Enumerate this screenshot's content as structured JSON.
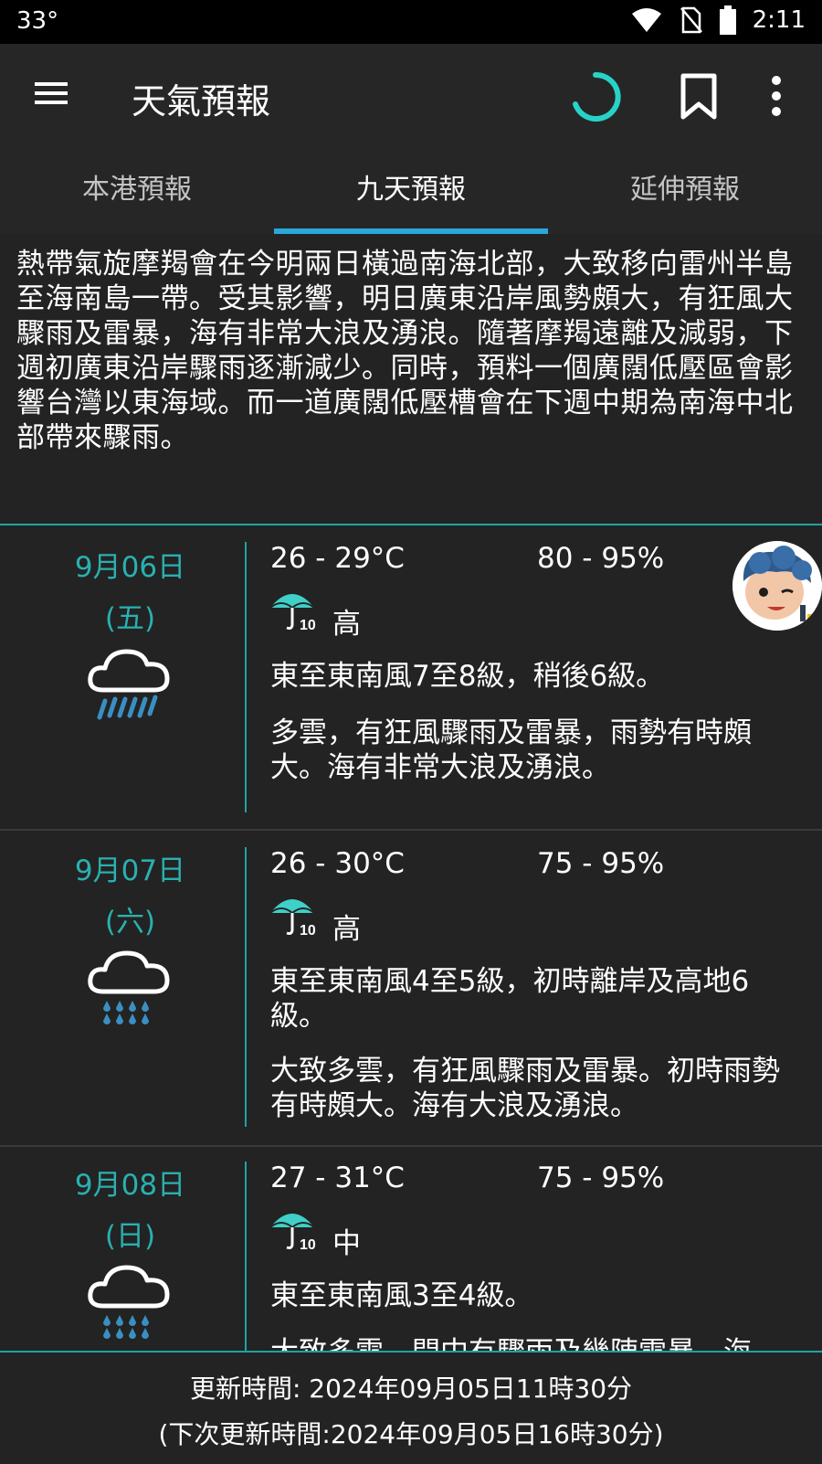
{
  "status_bar": {
    "temperature": "33°",
    "time": "2:11"
  },
  "app_bar": {
    "title": "天氣預報"
  },
  "tabs": [
    {
      "label": "本港預報",
      "active": false
    },
    {
      "label": "九天預報",
      "active": true
    },
    {
      "label": "延伸預報",
      "active": false
    }
  ],
  "synopsis": "熱帶氣旋摩羯會在今明兩日橫過南海北部，大致移向雷州半島至海南島一帶。受其影響，明日廣東沿岸風勢頗大，有狂風大驟雨及雷暴，海有非常大浪及湧浪。隨著摩羯遠離及減弱，下週初廣東沿岸驟雨逐漸減少。同時，預料一個廣闊低壓區會影響台灣以東海域。而一道廣闊低壓槽會在下週中期為南海中北部帶來驟雨。",
  "days": [
    {
      "date": "9月06日",
      "weekday": "(五)",
      "icon": "heavy-rain-icon",
      "temp": "26 - 29°C",
      "rh": "80 - 95%",
      "psr": "高",
      "wind": "東至東南風7至8級，稍後6級。",
      "desc": "多雲，有狂風驟雨及雷暴，雨勢有時頗大。海有非常大浪及湧浪。"
    },
    {
      "date": "9月07日",
      "weekday": "(六)",
      "icon": "showers-icon",
      "temp": "26 - 30°C",
      "rh": "75 - 95%",
      "psr": "高",
      "wind": "東至東南風4至5級，初時離岸及高地6級。",
      "desc": "大致多雲，有狂風驟雨及雷暴。初時雨勢有時頗大。海有大浪及湧浪。"
    },
    {
      "date": "9月08日",
      "weekday": "(日)",
      "icon": "showers-icon",
      "temp": "27 - 31°C",
      "rh": "75 - 95%",
      "psr": "中",
      "wind": "東至東南風3至4級。",
      "desc": "大致多雲，間中有驟雨及幾陣雷暴。海"
    }
  ],
  "footer": {
    "update_time": "更新時間: 2024年09月05日11時30分",
    "next_update_time": "(下次更新時間:2024年09月05日16時30分)"
  },
  "colors": {
    "accent": "#1fa3a3",
    "tab_indicator": "#2aa7d9",
    "rain": "#3a8fc2",
    "umbrella": "#3fd0c8"
  }
}
